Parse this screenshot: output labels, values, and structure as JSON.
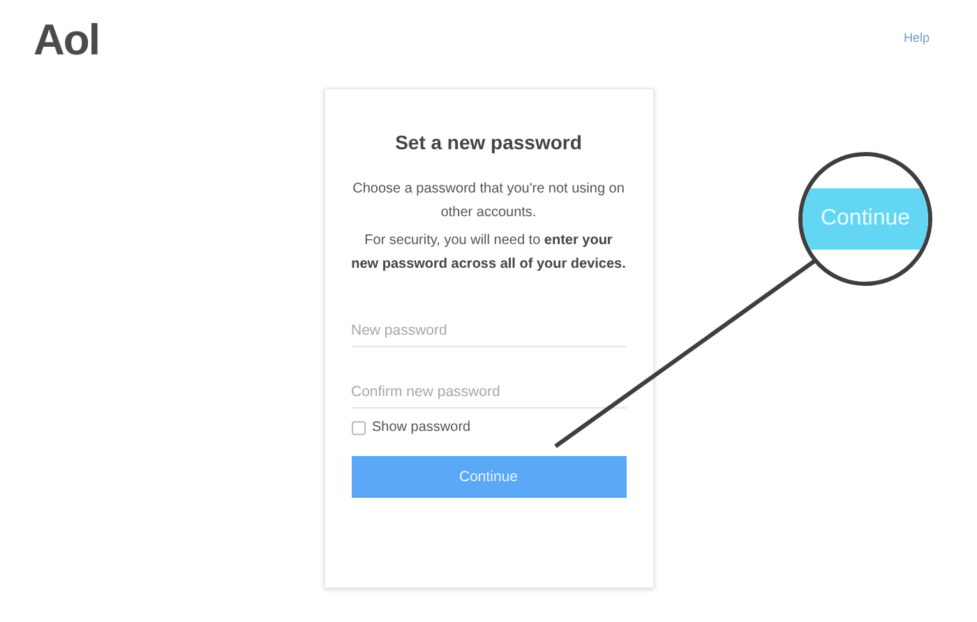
{
  "header": {
    "logo": "Aol",
    "help_link": "Help"
  },
  "card": {
    "title": "Set a new password",
    "paragraphs": [
      "Choose a password that you're not using on other accounts.",
      "For security, you will need to **enter your new password across all of your devices.**"
    ],
    "fields": [
      {
        "placeholder": "New password"
      },
      {
        "placeholder": "Confirm new password"
      }
    ],
    "show_password": {
      "label": "Show password",
      "checked": false
    },
    "button": "Continue"
  },
  "magnifier": {
    "label": "Continue"
  }
}
